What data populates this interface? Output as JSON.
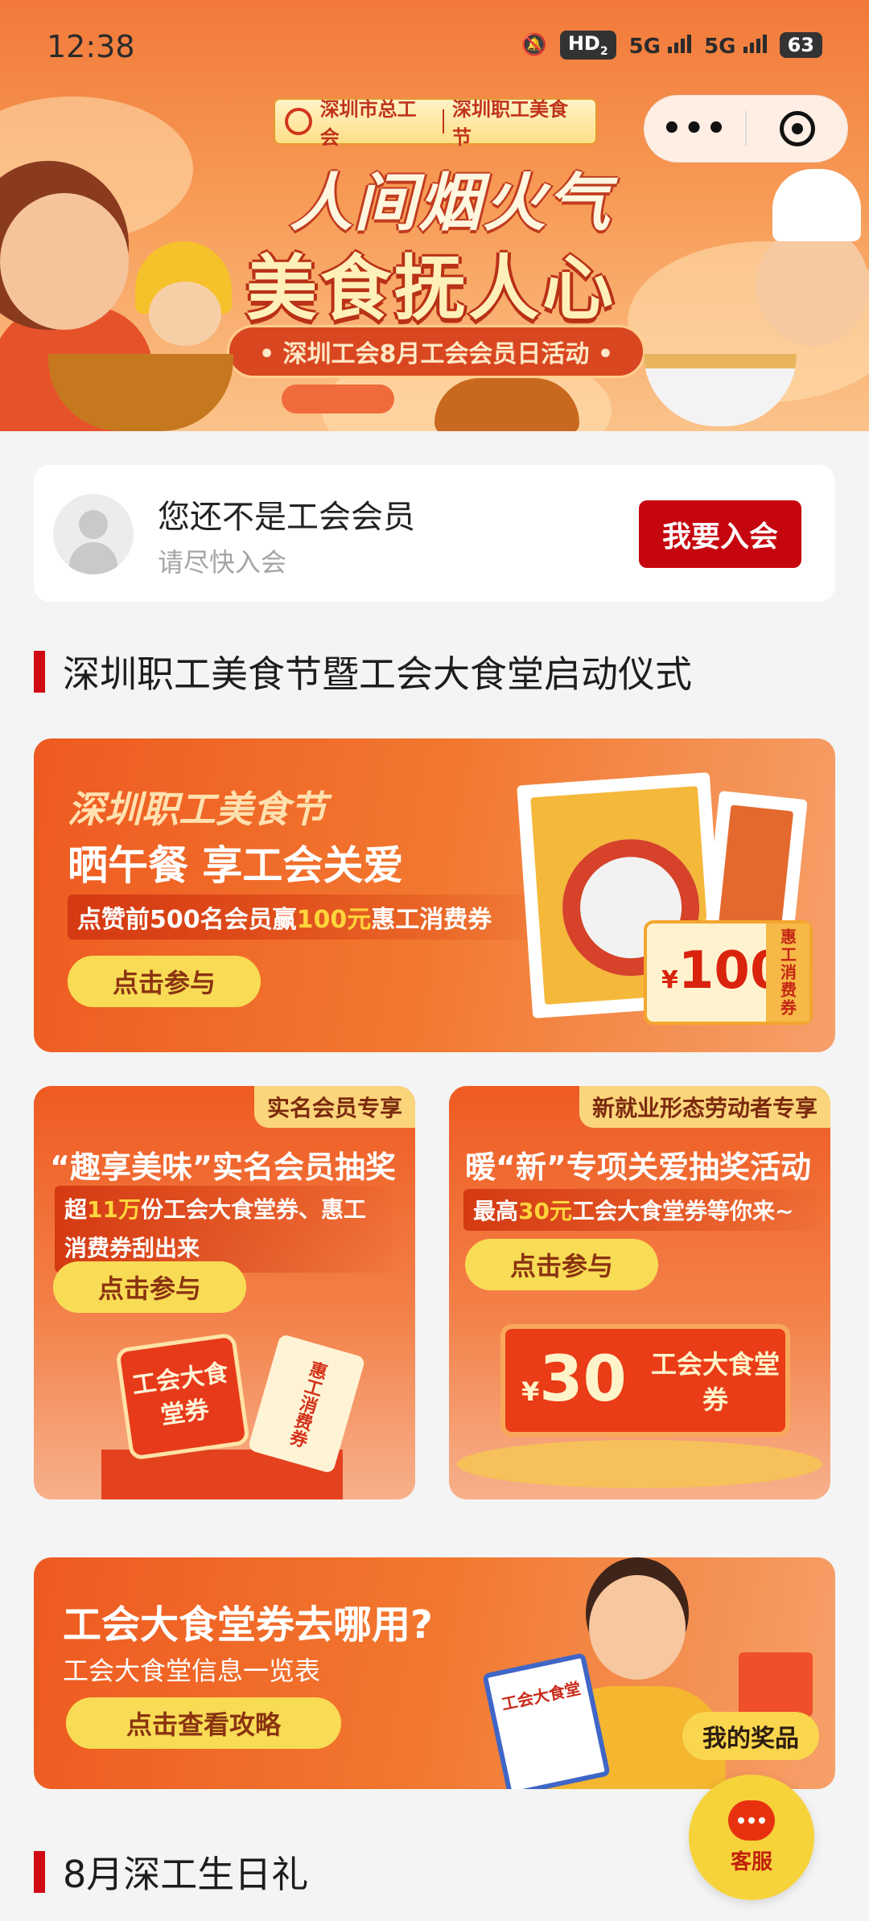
{
  "status_bar": {
    "time": "12:38",
    "hd": "HD",
    "hd_sub": "2",
    "net1": "5G",
    "net2": "5G",
    "battery": "63"
  },
  "mini_program": {
    "more_label": "•••",
    "close_icon": "target-circle-icon"
  },
  "hero": {
    "org_left": "深圳市总工会",
    "org_right": "深圳职工美食节",
    "title_line1": "人间烟火气",
    "title_line2": "美食抚人心",
    "subtitle": "• 深圳工会8月工会会员日活动 •"
  },
  "member": {
    "title": "您还不是工会会员",
    "subtitle": "请尽快入会",
    "join_button": "我要入会"
  },
  "section1": {
    "title": "深圳职工美食节暨工会大食堂启动仪式"
  },
  "banner_food_festival": {
    "title": "深圳职工美食节",
    "headline": "晒午餐  享工会关爱",
    "desc_pre": "点赞前500名会员赢",
    "desc_highlight": "100元",
    "desc_post": "惠工消费券",
    "button": "点击参与",
    "coupon_currency": "¥",
    "coupon_amount": "100",
    "coupon_side": "惠工消费券"
  },
  "banner_lottery_members": {
    "tag": "实名会员专享",
    "title": "“趣享美味”实名会员抽奖",
    "desc_pre": "超",
    "desc_highlight": "11万",
    "desc_post": "份工会大食堂券、惠工消费券刮出来",
    "button": "点击参与",
    "ticket_text": "工会大食堂券",
    "ticket2_text": "惠工消费券"
  },
  "banner_lottery_new": {
    "tag": "新就业形态劳动者专享",
    "title": "暖“新”专项关爱抽奖活动",
    "desc_pre": "最高",
    "desc_highlight": "30元",
    "desc_post": "工会大食堂券等你来~",
    "button": "点击参与",
    "coupon_currency": "¥",
    "coupon_amount": "30",
    "coupon_label": "工会大食堂券"
  },
  "banner_guide": {
    "title": "工会大食堂券去哪用?",
    "subtitle": "工会大食堂信息一览表",
    "button": "点击查看攻略",
    "clipboard_text": "工会大食堂"
  },
  "floating": {
    "prizes": "我的奖品",
    "service": "客服"
  },
  "section2": {
    "title": "8月深工生日礼"
  },
  "colors": {
    "accent_red": "#d10912",
    "join_red": "#c6060f",
    "banner_orange": "#ee5a21",
    "button_yellow": "#f8dc55"
  }
}
